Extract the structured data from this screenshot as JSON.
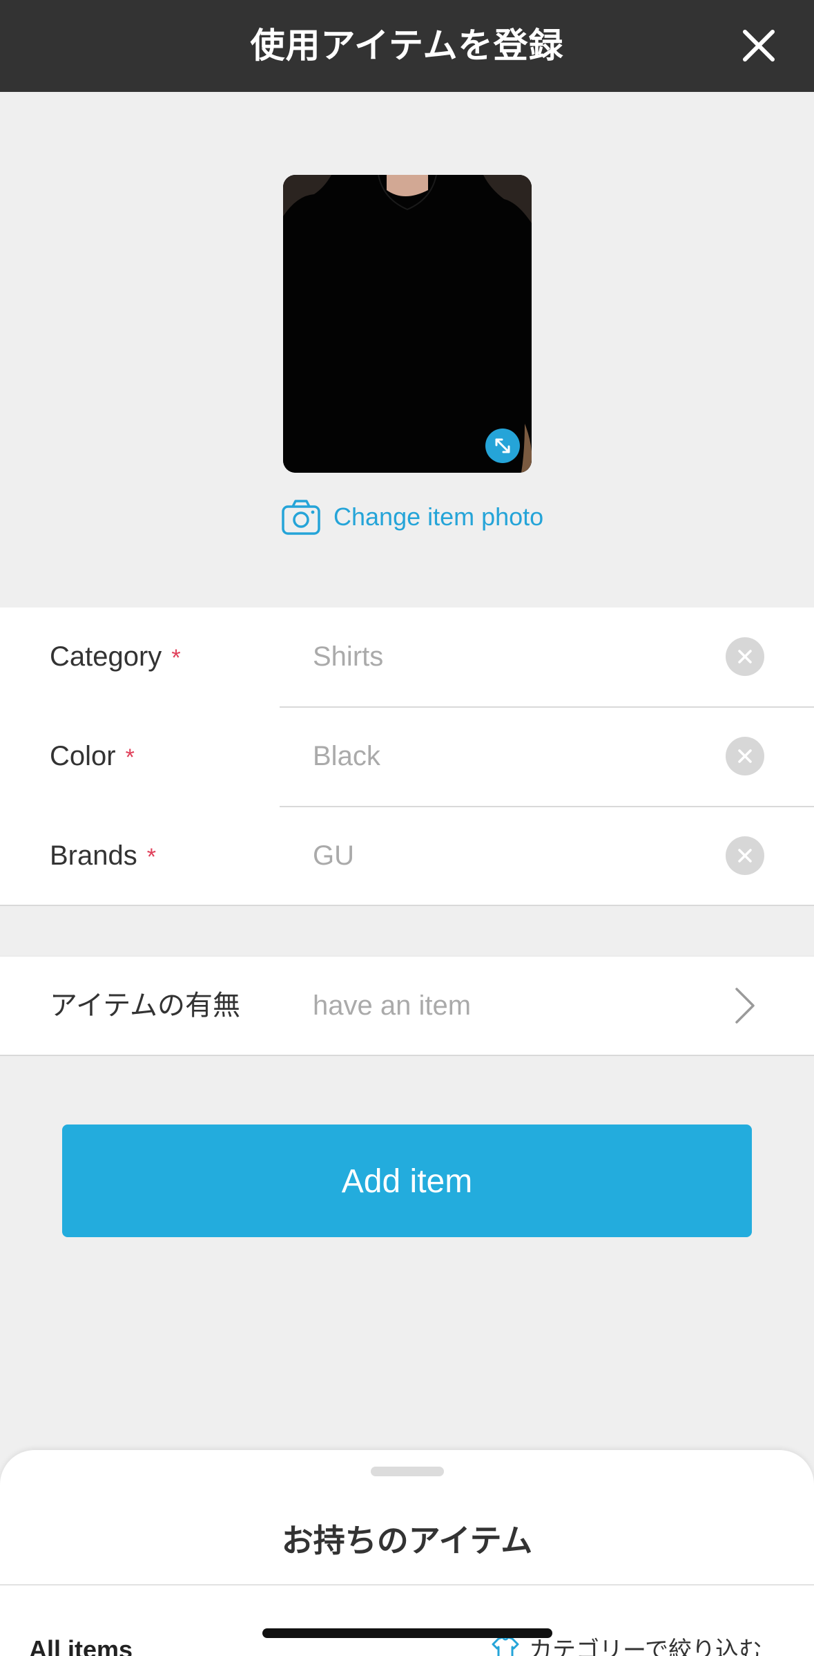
{
  "header": {
    "title": "使用アイテムを登録",
    "close_icon": "close-icon"
  },
  "photo": {
    "expand_icon": "expand-arrows-icon",
    "change_label": "Change item photo",
    "camera_icon": "camera-icon"
  },
  "form": {
    "required_mark": "*",
    "rows": [
      {
        "label": "Category",
        "value": "Shirts"
      },
      {
        "label": "Color",
        "value": "Black"
      },
      {
        "label": "Brands",
        "value": "GU"
      }
    ]
  },
  "ownership": {
    "label": "アイテムの有無",
    "value": "have an item"
  },
  "add_button": {
    "label": "Add item"
  },
  "sheet": {
    "title": "お持ちのアイテム",
    "all_items_label": "All items",
    "filter_label": "カテゴリーで絞り込む"
  },
  "colors": {
    "header_bg": "#333333",
    "accent": "#23acdd",
    "required": "#e0405a",
    "page_bg": "#efefef"
  }
}
